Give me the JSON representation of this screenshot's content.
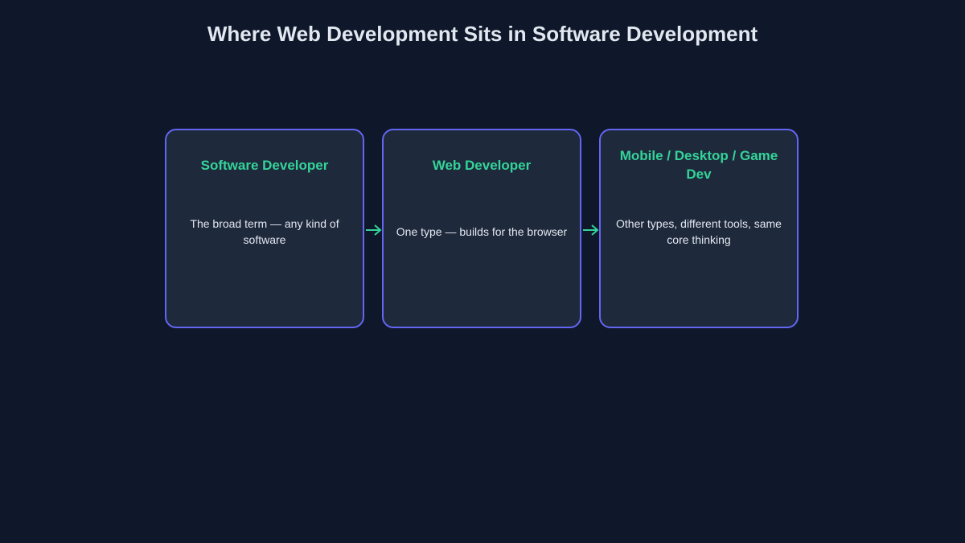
{
  "title": "Where Web Development Sits in Software Development",
  "colors": {
    "background": "#0f172a",
    "card_fill": "#1e293b",
    "card_border": "#6366f1",
    "accent_green": "#34d399",
    "text": "#e2e8f0"
  },
  "cards": [
    {
      "title": "Software Developer",
      "description": "The broad term — any kind of software"
    },
    {
      "title": "Web Developer",
      "description": "One type — builds for the browser"
    },
    {
      "title": "Mobile / Desktop / Game Dev",
      "description": "Other types, different tools, same core thinking"
    }
  ],
  "arrows": [
    "arrow-right-icon",
    "arrow-right-icon"
  ]
}
